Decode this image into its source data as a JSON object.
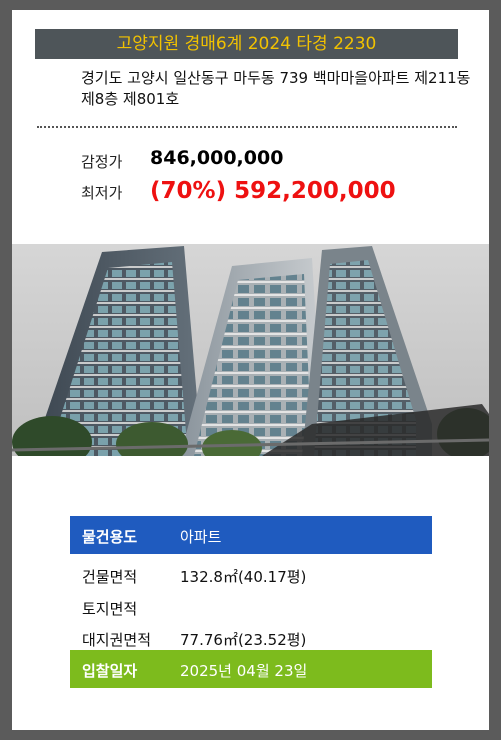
{
  "header": {
    "title": "고양지원 경매6계 2024 타경 2230"
  },
  "property": {
    "address": "경기도 고양시 일산동구 마두동 739 백마마을아파트 제211동 제8층 제801호"
  },
  "prices": {
    "appraisal_label": "감정가",
    "appraisal_value": "846,000,000",
    "minimum_label": "최저가",
    "minimum_value": "(70%) 592,200,000"
  },
  "photo": {
    "subject": "apartment building exterior"
  },
  "details": {
    "type_label": "물건용도",
    "type_value": "아파트",
    "building_area_label": "건물면적",
    "building_area_value": "132.8㎡(40.17평)",
    "land_area_label": "토지면적",
    "land_area_value": "",
    "land_right_label": "대지권면적",
    "land_right_value": "77.76㎡(23.52평)",
    "bid_date_label": "입찰일자",
    "bid_date_value": "2025년 04월 23일"
  },
  "colors": {
    "title_bg": "#4e5559",
    "title_text": "#f2c200",
    "minimum_price": "#ee1111",
    "type_row_bg": "#1f5bbf",
    "date_row_bg": "#7dbb1d"
  }
}
